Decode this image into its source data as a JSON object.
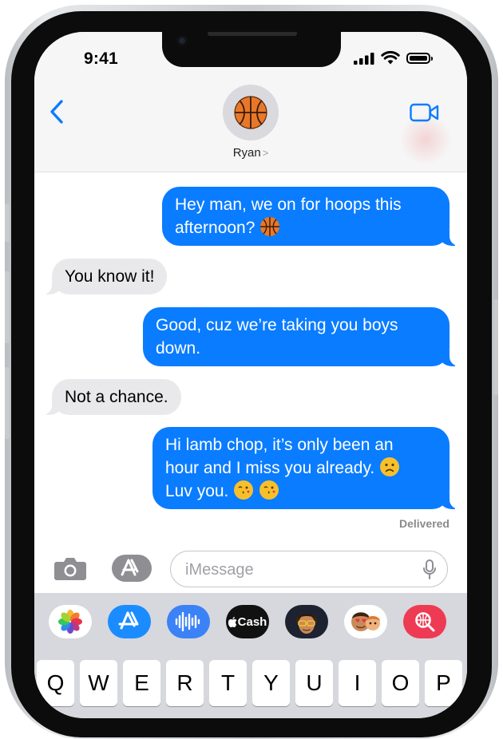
{
  "status_bar": {
    "time": "9:41"
  },
  "header": {
    "contact_name": "Ryan",
    "contact_chevron": ">",
    "icons": {
      "back": "chevron-left-icon",
      "video": "video-camera-icon",
      "avatar": "basketball-icon"
    }
  },
  "messages": [
    {
      "direction": "outgoing",
      "lines": [
        "Hey man, we on for hoops this",
        "afternoon?"
      ],
      "emoji": [
        "basketball"
      ]
    },
    {
      "direction": "incoming",
      "lines": [
        "You know it!"
      ]
    },
    {
      "direction": "outgoing",
      "lines": [
        "Good, cuz we’re taking you boys",
        "down."
      ]
    },
    {
      "direction": "incoming",
      "lines": [
        "Not a chance."
      ]
    },
    {
      "direction": "outgoing",
      "lines": [
        "Hi lamb chop, it’s only been an",
        "hour and I miss you already.",
        "Luv you."
      ],
      "emoji": [
        "slightly-frowning-face",
        "face-blowing-kiss",
        "face-blowing-kiss"
      ]
    }
  ],
  "delivered_label": "Delivered",
  "input": {
    "placeholder": "iMessage",
    "value": ""
  },
  "app_drawer": [
    {
      "name": "photos-app-icon"
    },
    {
      "name": "app-store-icon"
    },
    {
      "name": "audio-message-icon"
    },
    {
      "name": "apple-cash-icon",
      "label": "Cash"
    },
    {
      "name": "memoji-icon"
    },
    {
      "name": "memoji-stickers-icon"
    },
    {
      "name": "web-images-search-icon"
    }
  ],
  "keyboard_row": [
    "Q",
    "W",
    "E",
    "R",
    "T",
    "Y",
    "U",
    "I",
    "O",
    "P"
  ],
  "colors": {
    "outgoing_bubble": "#0a7cff",
    "incoming_bubble": "#e9e9eb",
    "accent": "#0a7cff"
  }
}
